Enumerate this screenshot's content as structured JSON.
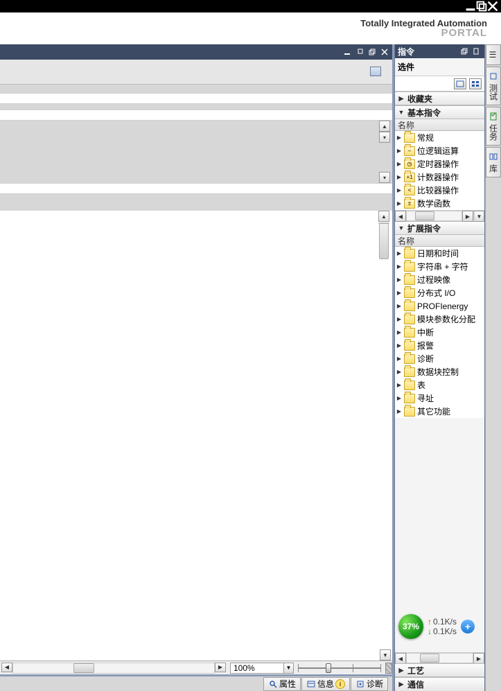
{
  "branding": {
    "line1": "Totally Integrated Automation",
    "line2": "PORTAL"
  },
  "side": {
    "pane_title": "指令",
    "options_label": "选件",
    "col_header": "名称",
    "sections": {
      "favorites": "收藏夹",
      "basic": "基本指令",
      "extended": "扩展指令",
      "technology": "工艺",
      "communication": "通信"
    },
    "basic_items": [
      {
        "label": "常规",
        "glyph": ""
      },
      {
        "label": "位逻辑运算",
        "glyph": "⎯"
      },
      {
        "label": "定时器操作",
        "glyph": "◷"
      },
      {
        "label": "计数器操作",
        "glyph": "+1"
      },
      {
        "label": "比较器操作",
        "glyph": "<"
      },
      {
        "label": "数学函数",
        "glyph": "±"
      }
    ],
    "ext_items": [
      {
        "label": "日期和时间"
      },
      {
        "label": "字符串 + 字符"
      },
      {
        "label": "过程映像"
      },
      {
        "label": "分布式 I/O"
      },
      {
        "label": "PROFIenergy"
      },
      {
        "label": "模块参数化分配"
      },
      {
        "label": "中断"
      },
      {
        "label": "报警"
      },
      {
        "label": "诊断"
      },
      {
        "label": "数据块控制"
      },
      {
        "label": "表"
      },
      {
        "label": "寻址"
      },
      {
        "label": "其它功能"
      }
    ]
  },
  "vtabs": {
    "instructions": "指令",
    "testing": "测试",
    "tasks": "任务",
    "libraries": "库"
  },
  "bottom_tabs": {
    "properties": "属性",
    "info": "信息",
    "diagnostics": "诊断"
  },
  "zoom": {
    "percent": "100%"
  },
  "net": {
    "pct": "37%",
    "up": "0.1K/s",
    "down": "0.1K/s"
  }
}
